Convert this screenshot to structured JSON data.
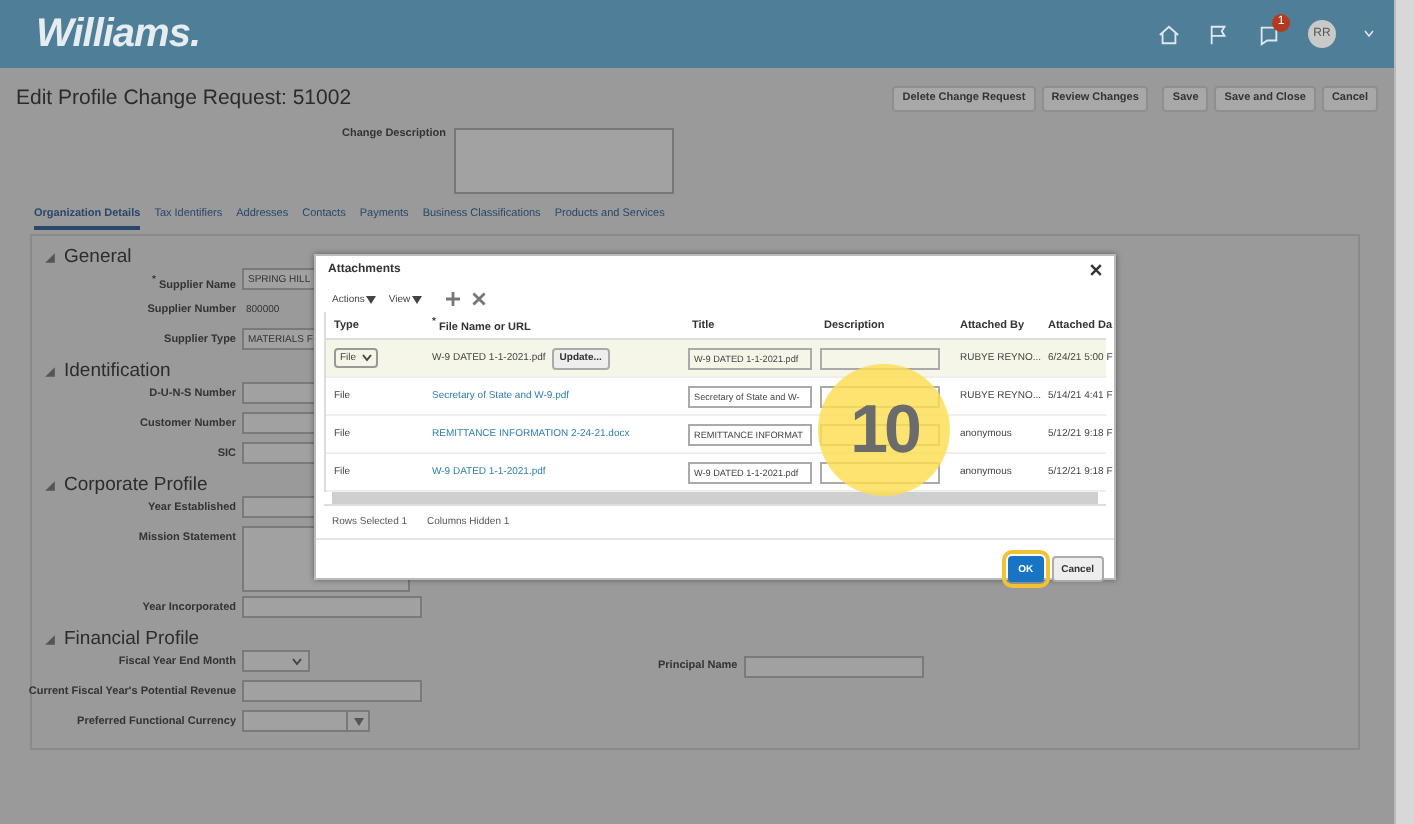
{
  "header": {
    "logo": "Williams.",
    "notification_badge": "1",
    "avatar": "RR"
  },
  "page_title": "Edit Profile Change Request: 51002",
  "actions": [
    "Delete Change Request",
    "Review Changes",
    "Save",
    "Save and Close",
    "Cancel"
  ],
  "change_description": {
    "label": "Change Description"
  },
  "tabs": [
    {
      "label": "Organization Details",
      "selected": true
    },
    {
      "label": "Tax Identifiers",
      "selected": false
    },
    {
      "label": "Addresses",
      "selected": false
    },
    {
      "label": "Contacts",
      "selected": false
    },
    {
      "label": "Payments",
      "selected": false
    },
    {
      "label": "Business Classifications",
      "selected": false
    },
    {
      "label": "Products and Services",
      "selected": false
    }
  ],
  "sections": [
    {
      "title": "General",
      "fields": [
        {
          "label": "Supplier Name",
          "mark": "*",
          "kind": "input",
          "value": "SPRING HILL"
        },
        {
          "label": "Supplier Number",
          "kind": "text",
          "value": "800000"
        },
        {
          "label": "Supplier Type",
          "kind": "input",
          "value": "MATERIALS F"
        }
      ]
    },
    {
      "title": "Identification",
      "fields": [
        {
          "label": "D-U-N-S Number",
          "kind": "input"
        },
        {
          "label": "Customer Number",
          "kind": "input"
        },
        {
          "label": "SIC",
          "kind": "input"
        }
      ]
    },
    {
      "title": "Corporate Profile",
      "fields": [
        {
          "label": "Year Established",
          "kind": "input"
        },
        {
          "label": "Mission Statement",
          "kind": "textarea"
        },
        {
          "label": "Year Incorporated",
          "kind": "input"
        }
      ]
    },
    {
      "title": "Financial Profile",
      "fields": [
        {
          "label": "Fiscal Year End Month",
          "kind": "select"
        },
        {
          "label": "Current Fiscal Year's Potential Revenue",
          "kind": "input"
        },
        {
          "label": "Preferred Functional Currency",
          "kind": "combo"
        }
      ]
    }
  ],
  "principal_name": {
    "label": "Principal Name"
  },
  "dialog": {
    "title": "Attachments",
    "menus": [
      "Actions",
      "View"
    ],
    "columns": [
      {
        "label": "Type"
      },
      {
        "label": "File Name or URL",
        "mark": "*"
      },
      {
        "label": "Title"
      },
      {
        "label": "Description"
      },
      {
        "label": "Attached By"
      },
      {
        "label": "Attached Da"
      }
    ],
    "rows": [
      {
        "selected": true,
        "type": "File",
        "file": "W-9 DATED 1-1-2021.pdf",
        "update": "Update...",
        "title": "W-9 DATED 1-1-2021.pdf",
        "attached_by": "RUBYE REYNO...",
        "attached_date": "6/24/21 5:00 F"
      },
      {
        "selected": false,
        "type": "File",
        "file": "Secretary of State and W-9.pdf",
        "title": "Secretary of State and W-",
        "attached_by": "RUBYE REYNO...",
        "attached_date": "5/14/21 4:41 F"
      },
      {
        "selected": false,
        "type": "File",
        "file": "REMITTANCE INFORMATION 2-24-21.docx",
        "title": "REMITTANCE INFORMAT",
        "attached_by": "anonymous",
        "attached_date": "5/12/21 9:18 F"
      },
      {
        "selected": false,
        "type": "File",
        "file": "W-9 DATED 1-1-2021.pdf",
        "title": "W-9 DATED 1-1-2021.pdf",
        "attached_by": "anonymous",
        "attached_date": "5/12/21 9:18 F"
      }
    ],
    "status": [
      "Rows Selected  1",
      "Columns Hidden  1"
    ],
    "buttons": [
      "OK",
      "Cancel"
    ]
  },
  "step_marker": "10"
}
